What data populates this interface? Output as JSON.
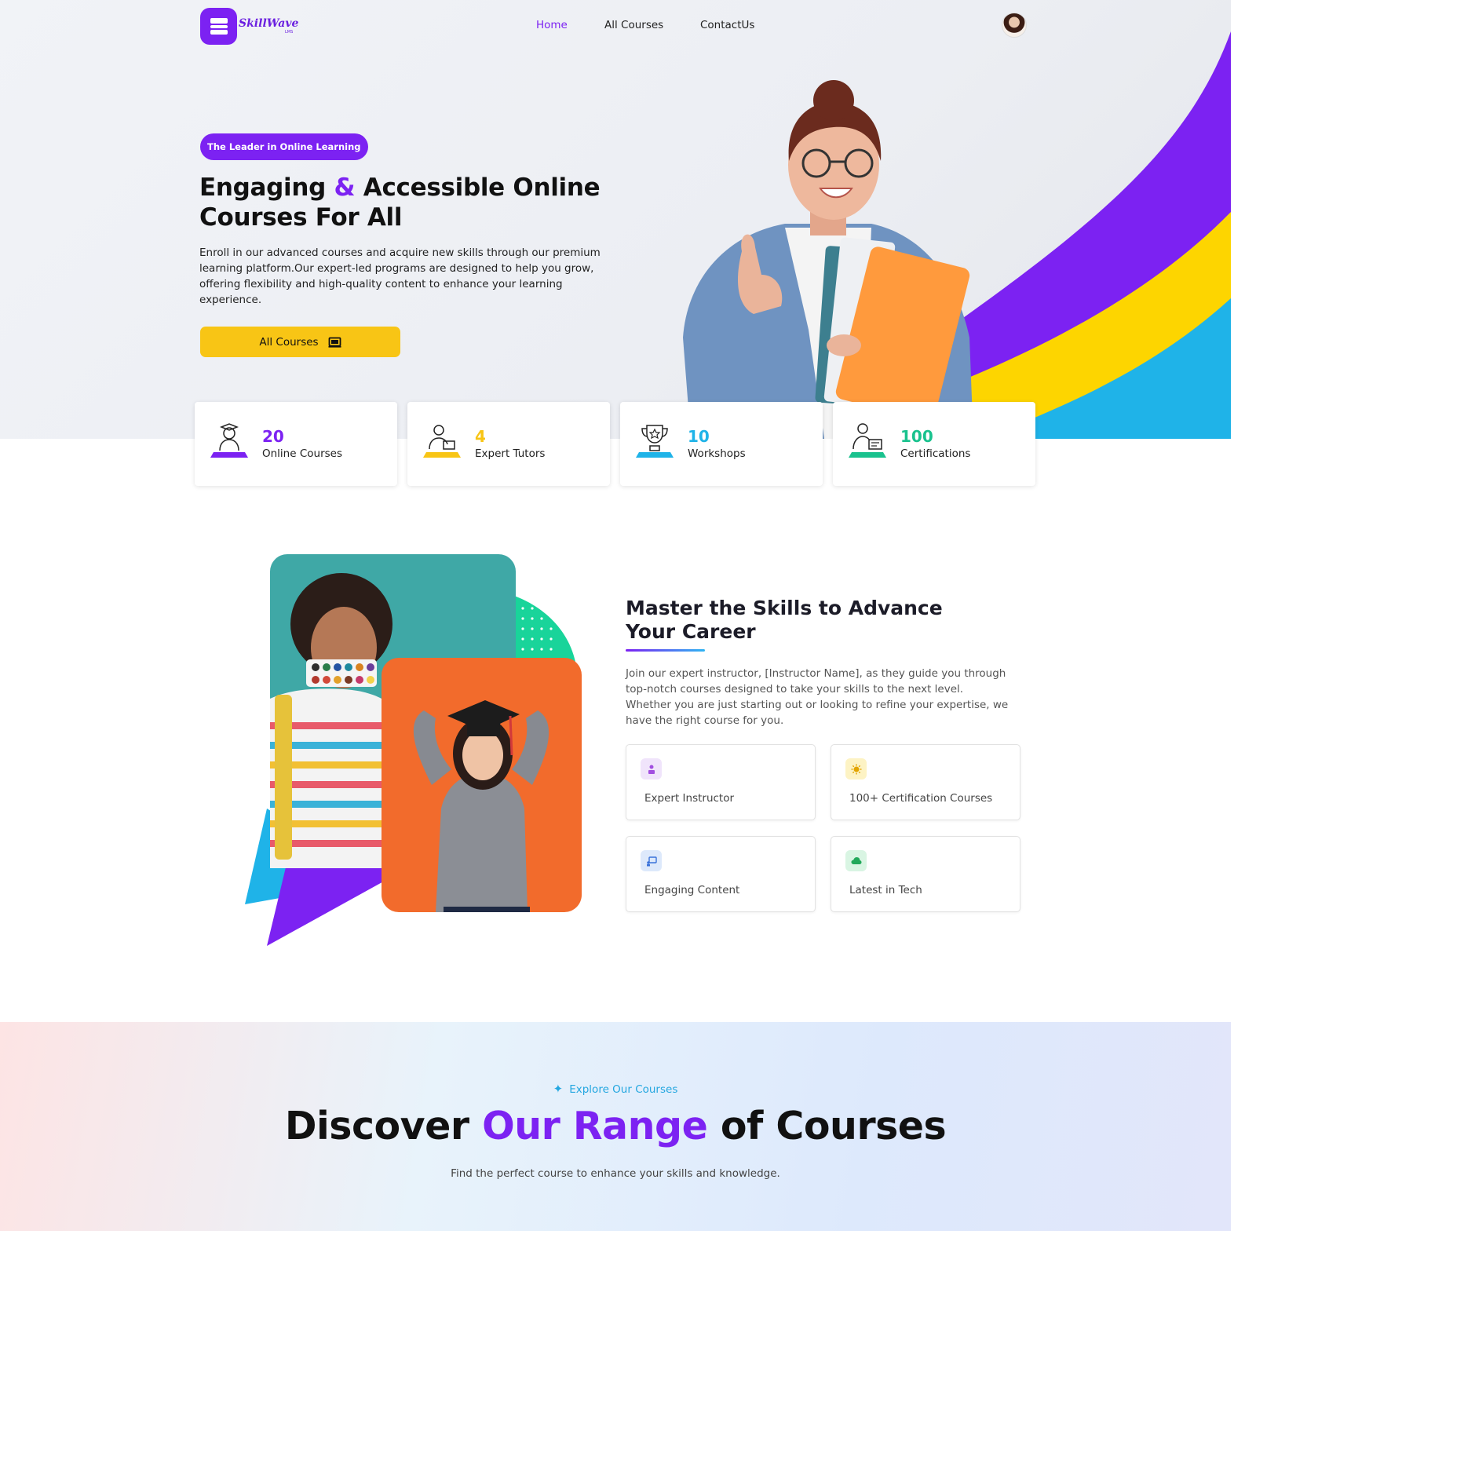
{
  "brand": {
    "name": "SkillWave",
    "tagline": "LMS"
  },
  "nav": {
    "links": [
      {
        "label": "Home",
        "active": true
      },
      {
        "label": "All Courses",
        "active": false
      },
      {
        "label": "ContactUs",
        "active": false
      }
    ]
  },
  "hero": {
    "badge": "The Leader in Online Learning",
    "title_part1": "Engaging",
    "title_amp": "&",
    "title_part2": "Accessible Online Courses For All",
    "description": "Enroll in our advanced courses and acquire new skills through our premium learning platform.Our expert-led programs are designed to help you grow, offering flexibility and high-quality content to enhance your learning experience.",
    "button_label": "All Courses",
    "button_icon": "laptop-icon"
  },
  "stats": [
    {
      "value": "20",
      "label": "Online Courses",
      "icon": "graduate-icon",
      "color": "#7c22f2"
    },
    {
      "value": "4",
      "label": "Expert Tutors",
      "icon": "tutor-icon",
      "color": "#f8c515"
    },
    {
      "value": "10",
      "label": "Workshops",
      "icon": "trophy-icon",
      "color": "#1fb3e8"
    },
    {
      "value": "100",
      "label": "Certifications",
      "icon": "certificate-icon",
      "color": "#19c28e"
    }
  ],
  "about": {
    "title": "Master the Skills to Advance Your Career",
    "description": "Join our expert instructor, [Instructor Name], as they guide you through top-notch courses designed to take your skills to the next level. Whether you are just starting out or looking to refine your expertise, we have the right course for you.",
    "features": [
      {
        "label": "Expert Instructor",
        "icon": "instructor-icon",
        "bg": "#f0e4fb"
      },
      {
        "label": "100+ Certification Courses",
        "icon": "sun-icon",
        "bg": "#fdf3c4"
      },
      {
        "label": "Engaging Content",
        "icon": "presentation-icon",
        "bg": "#dde9fb"
      },
      {
        "label": "Latest in Tech",
        "icon": "cloud-icon",
        "bg": "#d9f5e3"
      }
    ]
  },
  "courses": {
    "eyebrow": "Explore Our Courses",
    "title_part1": "Discover",
    "title_accent": "Our Range",
    "title_part2": "of Courses",
    "subtitle": "Find the perfect course to enhance your skills and knowledge."
  }
}
